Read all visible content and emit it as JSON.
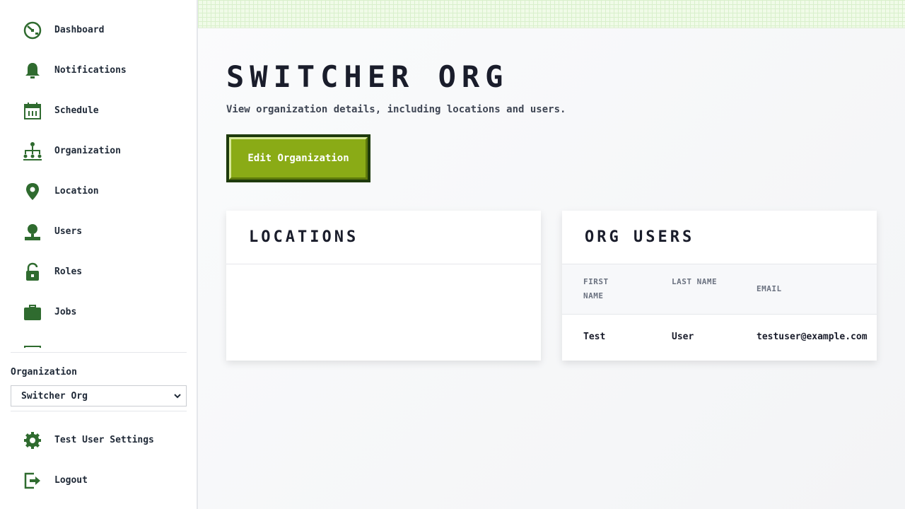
{
  "sidebar": {
    "items": [
      {
        "label": "Dashboard",
        "icon": "dashboard-icon"
      },
      {
        "label": "Notifications",
        "icon": "bell-icon"
      },
      {
        "label": "Schedule",
        "icon": "calendar-icon"
      },
      {
        "label": "Organization",
        "icon": "org-chart-icon"
      },
      {
        "label": "Location",
        "icon": "map-pin-icon"
      },
      {
        "label": "Users",
        "icon": "user-icon"
      },
      {
        "label": "Roles",
        "icon": "lock-icon"
      },
      {
        "label": "Jobs",
        "icon": "briefcase-icon"
      }
    ],
    "org_label": "Organization",
    "org_selected": "Switcher Org",
    "settings_label": "Test User Settings",
    "logout_label": "Logout"
  },
  "main": {
    "title": "Switcher Org",
    "subtitle": "View organization details, including locations and users.",
    "edit_button": "Edit Organization",
    "locations": {
      "title": "Locations"
    },
    "org_users": {
      "title": "Org Users",
      "columns": [
        "First Name",
        "Last Name",
        "Email"
      ],
      "rows": [
        {
          "first": "Test",
          "last": "User",
          "email": "testuser@example.com"
        }
      ]
    }
  },
  "colors": {
    "icon_green": "#2f6b2f",
    "button_face": "#8aab16",
    "button_border": "#1e3a0c"
  }
}
